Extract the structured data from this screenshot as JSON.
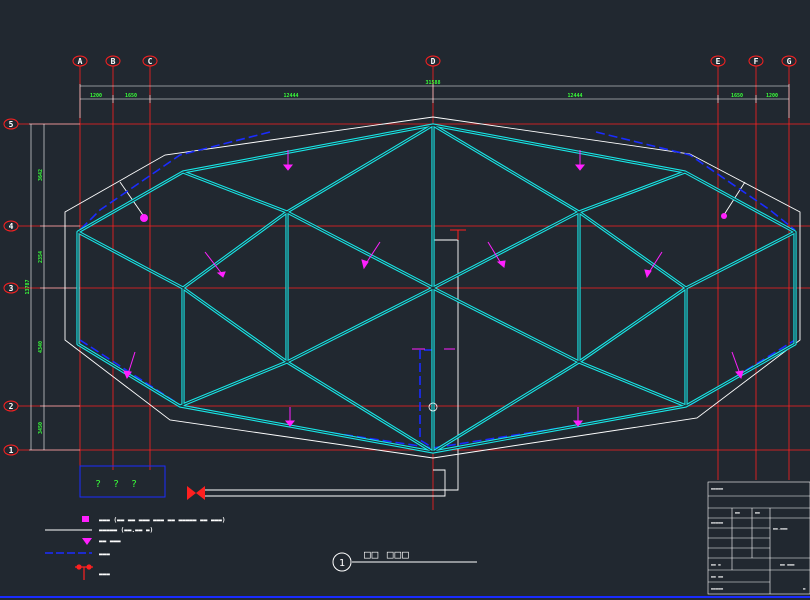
{
  "drawing": {
    "background": "#212830",
    "colors": {
      "grid": "#ff2020",
      "structure": "#18e6e6",
      "outline": "#ffffff",
      "dashed": "#1a2cff",
      "dimension_text": "#39ff39",
      "marker": "#ff20ff"
    }
  },
  "grid_axes": {
    "columns": [
      "A",
      "B",
      "C",
      "D",
      "E",
      "F",
      "G"
    ],
    "rows": [
      "5",
      "4",
      "3",
      "2",
      "1"
    ]
  },
  "dimensions": {
    "top": [
      "1200",
      "1650",
      "12444",
      "12444",
      "1650",
      "1200"
    ],
    "top_total": "31588",
    "left": [
      "3642",
      "2354",
      "4340",
      "3450"
    ],
    "left_total": "13787"
  },
  "detail_box": {
    "marks": [
      "?",
      "?",
      "?"
    ]
  },
  "legend": [
    {
      "icon": "magenta-square-icon",
      "text": "▬▬▬ (▬▬ ▬▬ ▬▬▬ ▬▬▬ ▬▬ ▬▬▬▬▬ ▬▬ ▬▬▬)"
    },
    {
      "icon": "white-line-icon",
      "text": "▬▬▬▬▬ (▬▬.▬▬ ▬)"
    },
    {
      "icon": "magenta-arrow-icon",
      "text": "▬▬ ▬▬▬"
    },
    {
      "icon": "blue-dash-line-icon",
      "text": "▬▬▬"
    },
    {
      "icon": "downpipe-icon",
      "text": "▬▬▬"
    }
  ],
  "section_title": {
    "number": "1",
    "text": "□□ □□□"
  },
  "title_block": {
    "cells": [
      "▬▬▬▬▬",
      "▬▬",
      "▬▬",
      "▬▬▬▬▬",
      "▬▬.▬▬▬",
      "▬▬ ▬",
      "▬▬ ▬▬▬",
      "▬▬ ▬▬",
      "▬▬▬▬▬",
      "▬"
    ]
  }
}
